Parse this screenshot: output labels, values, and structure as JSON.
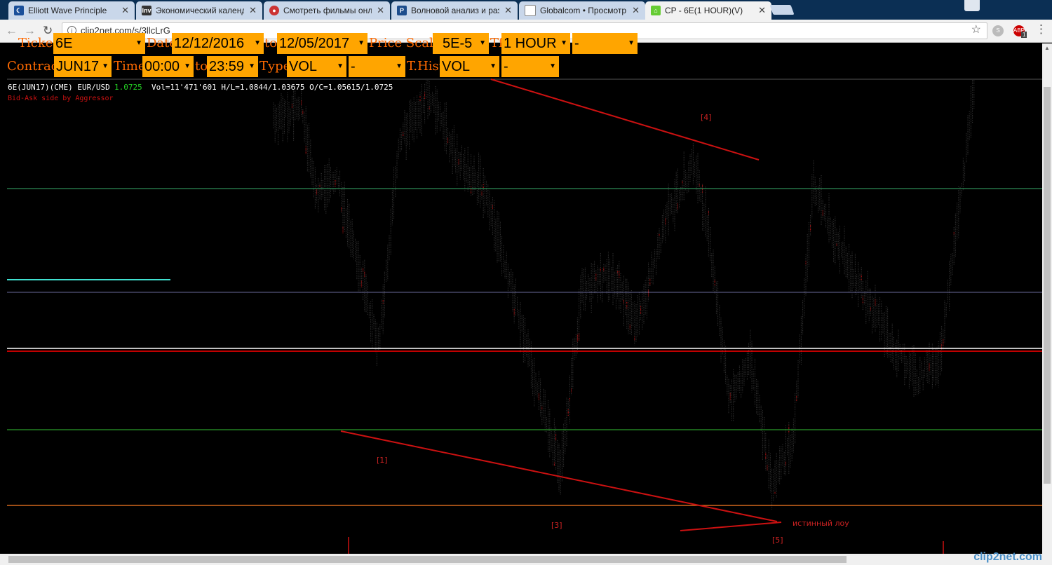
{
  "browser": {
    "tabs": [
      {
        "title": "Elliott Wave Principle",
        "icon": "wave-icon",
        "active": false
      },
      {
        "title": "Экономический календ",
        "icon": "investing-icon",
        "active": false
      },
      {
        "title": "Смотреть фильмы онла",
        "icon": "film-icon",
        "active": false
      },
      {
        "title": "Волновой анализ и раз",
        "icon": "p-logo-icon",
        "active": false
      },
      {
        "title": "Globalcom • Просмотр",
        "icon": "document-icon",
        "active": false
      },
      {
        "title": "CP - 6E(1 HOUR)(V)",
        "icon": "house-icon",
        "active": true
      }
    ],
    "url": "clip2net.com/s/3llcLrG",
    "extension_badge": "1",
    "extension_label": "ABP"
  },
  "form": {
    "row1": {
      "ticker_label": "Ticker",
      "ticker_value": "6E",
      "date_label": "Date",
      "date_from": "12/12/2016",
      "to_label": "to",
      "date_to": "12/05/2017",
      "price_scale_label": "Price Scale",
      "price_scale_value": "5E-5",
      "tf_label": "Tf",
      "tf_value": "1 HOUR",
      "extra_value": "-"
    },
    "row2": {
      "contract_label": "Contract",
      "contract_value": "JUN17",
      "time_label": "Time",
      "time_from": "00:00",
      "to_label": "to",
      "time_to": "23:59",
      "type_label": "Type",
      "type_value": "VOL",
      "type_extra": "-",
      "thist_label": "T.Hist",
      "thist_value": "VOL",
      "thist_extra": "-"
    }
  },
  "chart_info": {
    "symbol": "6E(JUN17)(CME) EUR/USD",
    "last_price": "1.0725",
    "stats": "Vol=11'471'601 H/L=1.0844/1.03675 O/C=1.05615/1.0725",
    "credit": "Bid-Ask side by Aggressor"
  },
  "annotations": {
    "w1": "[1]",
    "w3": "[3]",
    "w4": "[4]",
    "w5": "[5]",
    "true_low": "истинный лоу"
  },
  "watermark": "clip2net.com",
  "colors": {
    "accent_orange": "#ffa500",
    "label_orange": "#ff6a00",
    "profile_green": "#0a8c0a",
    "profile_blue": "#1414e6",
    "trendline_red": "#cc1111"
  }
}
